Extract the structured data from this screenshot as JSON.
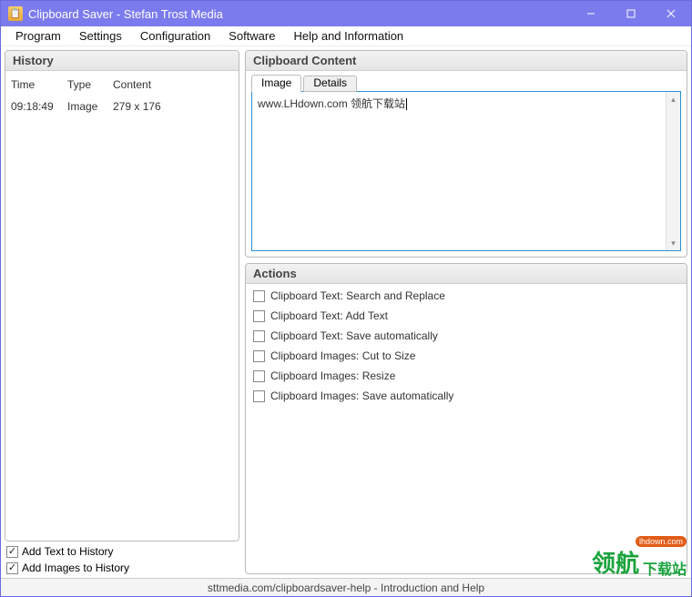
{
  "titlebar": {
    "title": "Clipboard Saver - Stefan Trost Media"
  },
  "menubar": [
    "Program",
    "Settings",
    "Configuration",
    "Software",
    "Help and Information"
  ],
  "history": {
    "title": "History",
    "columns": {
      "time": "Time",
      "type": "Type",
      "content": "Content"
    },
    "rows": [
      {
        "time": "09:18:49",
        "type": "Image",
        "content": "279 x 176"
      }
    ]
  },
  "history_options": {
    "add_text": {
      "label": "Add Text to History",
      "checked": true
    },
    "add_images": {
      "label": "Add Images to History",
      "checked": true
    }
  },
  "clipboard_content": {
    "title": "Clipboard Content",
    "tabs": {
      "image": "Image",
      "details": "Details"
    },
    "text": "www.LHdown.com  领航下载站"
  },
  "actions": {
    "title": "Actions",
    "items": [
      {
        "label": "Clipboard Text: Search and Replace",
        "checked": false
      },
      {
        "label": "Clipboard Text: Add Text",
        "checked": false
      },
      {
        "label": "Clipboard Text: Save automatically",
        "checked": false
      },
      {
        "label": "Clipboard Images: Cut to Size",
        "checked": false
      },
      {
        "label": "Clipboard Images: Resize",
        "checked": false
      },
      {
        "label": "Clipboard Images: Save automatically",
        "checked": false
      }
    ]
  },
  "statusbar": {
    "text": "sttmedia.com/clipboardsaver-help - Introduction and Help"
  },
  "watermark": {
    "main": "领航",
    "sub": "下载站",
    "badge": "lhdown.com"
  }
}
